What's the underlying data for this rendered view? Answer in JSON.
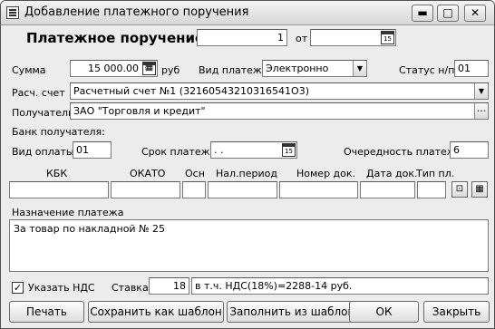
{
  "window": {
    "title": "Добавление платежного поручения",
    "buttons": {
      "minimize": "▬",
      "maximize": "□",
      "close": "✕"
    }
  },
  "header": {
    "title": "Платежное поручение №",
    "number": "1",
    "date_label": "от",
    "date_value": ""
  },
  "amount": {
    "label": "Сумма",
    "value": "15 000.00",
    "unit": "руб"
  },
  "payment_type": {
    "label": "Вид платежа",
    "value": "Электронно"
  },
  "status": {
    "label": "Статус н/п",
    "value": "01"
  },
  "account": {
    "label": "Расч. счет",
    "value": "Расчетный счет №1 (32160543210316541O3)"
  },
  "recipient": {
    "label": "Получатель",
    "value": "ЗАО \"Торговля и кредит\"",
    "more_button": "..."
  },
  "recipient_bank": {
    "label": "Банк получателя:"
  },
  "pay_kind": {
    "label": "Вид оплаты",
    "value": "01"
  },
  "due_date": {
    "label": "Срок платежа",
    "value": ". ."
  },
  "priority": {
    "label": "Очередность платежа",
    "value": "6"
  },
  "tax": {
    "columns": [
      "КБК",
      "ОКАТО",
      "Осн",
      "Нал.период",
      "Номер док.",
      "Дата док.",
      "Тип пл."
    ],
    "values": [
      "",
      "",
      "",
      "",
      "",
      "",
      ""
    ]
  },
  "purpose": {
    "label": "Назначение платежа",
    "text": "За товар по накладной № 25"
  },
  "vat": {
    "checkbox_label": "Указать НДС",
    "checked_mark": "✓",
    "rate_label": "Ставка",
    "rate_value": "18",
    "summary": "в т.ч. НДС(18%)=2288-14 руб."
  },
  "footer": {
    "print": "Печать",
    "save_template": "Сохранить как шаблон",
    "fill_template": "Заполнить из шаблона",
    "ok": "ОК",
    "close": "Закрыть"
  },
  "icons": {
    "calendar": "15",
    "calculator": "▦",
    "dropdown": "▼"
  }
}
